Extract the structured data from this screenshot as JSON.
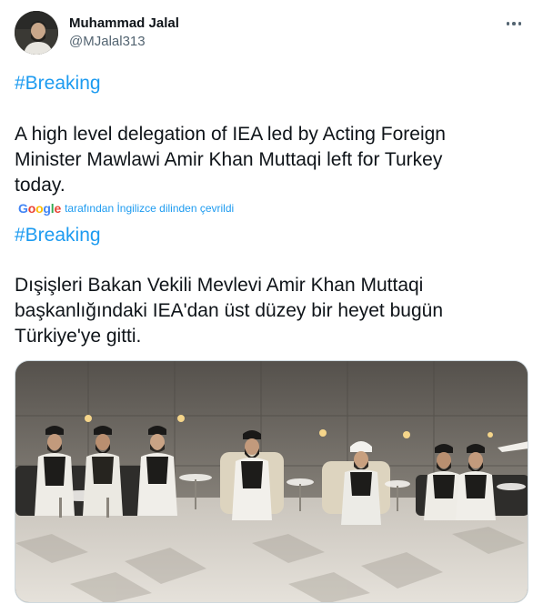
{
  "author": {
    "display_name": "Muhammad Jalal",
    "handle": "@MJalal313"
  },
  "tweet": {
    "hashtag_original": "#Breaking",
    "text_original_lines": [
      "A high level delegation of IEA led by Acting Foreign",
      "Minister Mawlawi Amir Khan Muttaqi left for Turkey",
      "today."
    ],
    "translation_note": "tarafından İngilizce dilinden çevrildi",
    "google_logo": [
      "G",
      "o",
      "o",
      "g",
      "l",
      "e"
    ],
    "hashtag_translated": "#Breaking",
    "text_translated_lines": [
      "Dışişleri Bakan Vekili Mevlevi Amir Khan Muttaqi",
      "başkanlığındaki IEA'dan üst düzey bir heyet bugün",
      "Türkiye'ye gitti."
    ]
  },
  "icons": {
    "more": "more-options-icon"
  },
  "colors": {
    "link": "#1d9bf0",
    "text": "#0f1419",
    "muted": "#536471"
  }
}
